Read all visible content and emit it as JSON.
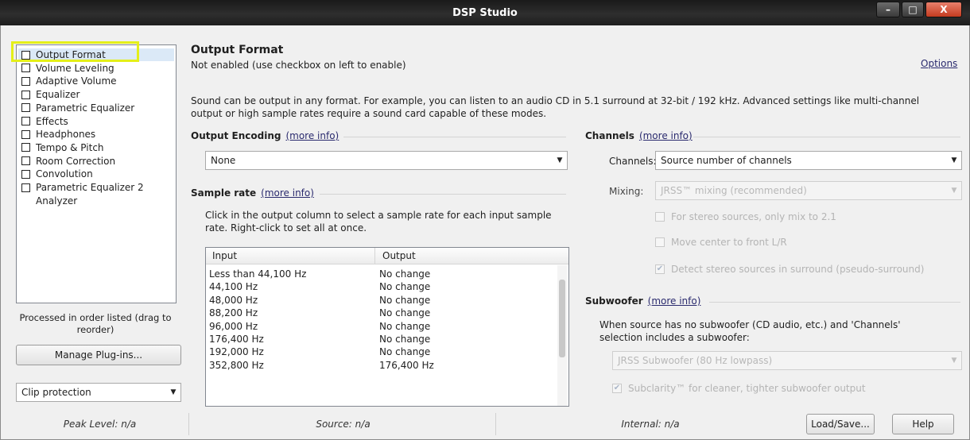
{
  "window": {
    "title": "DSP Studio",
    "min": "–",
    "max": "□",
    "close": "X"
  },
  "sidebar": {
    "plugins": [
      {
        "label": "Output Format",
        "checkbox": true,
        "selected": true
      },
      {
        "label": "Volume Leveling",
        "checkbox": true
      },
      {
        "label": "Adaptive Volume",
        "checkbox": true
      },
      {
        "label": "Equalizer",
        "checkbox": true
      },
      {
        "label": "Parametric Equalizer",
        "checkbox": true
      },
      {
        "label": "Effects",
        "checkbox": true
      },
      {
        "label": "Headphones",
        "checkbox": true
      },
      {
        "label": "Tempo & Pitch",
        "checkbox": true
      },
      {
        "label": "Room Correction",
        "checkbox": true
      },
      {
        "label": "Convolution",
        "checkbox": true
      },
      {
        "label": "Parametric Equalizer 2",
        "checkbox": true
      },
      {
        "label": "Analyzer",
        "checkbox": false
      }
    ],
    "processed_note": "Processed in order listed (drag to reorder)",
    "manage_button": "Manage Plug-ins...",
    "clip_protection": "Clip protection"
  },
  "main": {
    "title": "Output Format",
    "status": "Not enabled (use checkbox on left to enable)",
    "options_link": "Options",
    "description": [
      "Sound can be output in any format.  For example, you can listen to an audio CD in 5.1 surround at 32-bit / 192 kHz.  Advanced settings like multi-channel",
      "output or high sample rates require a sound card capable of these modes."
    ],
    "more_info": "(more info)",
    "encoding": {
      "label": "Output Encoding",
      "value": "None"
    },
    "sample_rate": {
      "label": "Sample rate",
      "help": [
        "Click in the output column to select a sample rate for each input sample",
        "rate.  Right-click to set all at once."
      ],
      "columns": [
        "Input",
        "Output"
      ],
      "rows": [
        {
          "input": "Less than 44,100 Hz",
          "output": "No change"
        },
        {
          "input": "44,100 Hz",
          "output": "No change"
        },
        {
          "input": "48,000 Hz",
          "output": "No change"
        },
        {
          "input": "88,200 Hz",
          "output": "No change"
        },
        {
          "input": "96,000 Hz",
          "output": "No change"
        },
        {
          "input": "176,400 Hz",
          "output": "No change"
        },
        {
          "input": "192,000 Hz",
          "output": "No change"
        },
        {
          "input": "352,800 Hz",
          "output": "176,400 Hz"
        }
      ]
    },
    "channels": {
      "label": "Channels",
      "channels_label": "Channels:",
      "channels_value": "Source number of channels",
      "mixing_label": "Mixing:",
      "mixing_value": "JRSS™ mixing (recommended)",
      "options": [
        {
          "label": "For stereo sources, only mix to 2.1",
          "checked": false
        },
        {
          "label": "Move center to front L/R",
          "checked": false
        },
        {
          "label": "Detect stereo sources in surround (pseudo-surround)",
          "checked": true
        }
      ]
    },
    "subwoofer": {
      "label": "Subwoofer",
      "help": [
        "When source has no subwoofer (CD audio, etc.) and 'Channels'",
        "selection includes a subwoofer:"
      ],
      "value": "JRSS Subwoofer (80 Hz lowpass)",
      "subclarity": "Subclarity™ for cleaner, tighter subwoofer output",
      "subclarity_checked": true
    }
  },
  "statusbar": {
    "peak": "Peak Level: n/a",
    "source": "Source: n/a",
    "internal": "Internal: n/a",
    "load_save": "Load/Save...",
    "help": "Help"
  },
  "colors": {
    "highlight": "#e4ef19",
    "selection": "#dbe9f7",
    "link": "#2a2a6e"
  },
  "icons": {
    "combo_arrow": "chevron-down-icon",
    "check": "checkmark-icon"
  }
}
